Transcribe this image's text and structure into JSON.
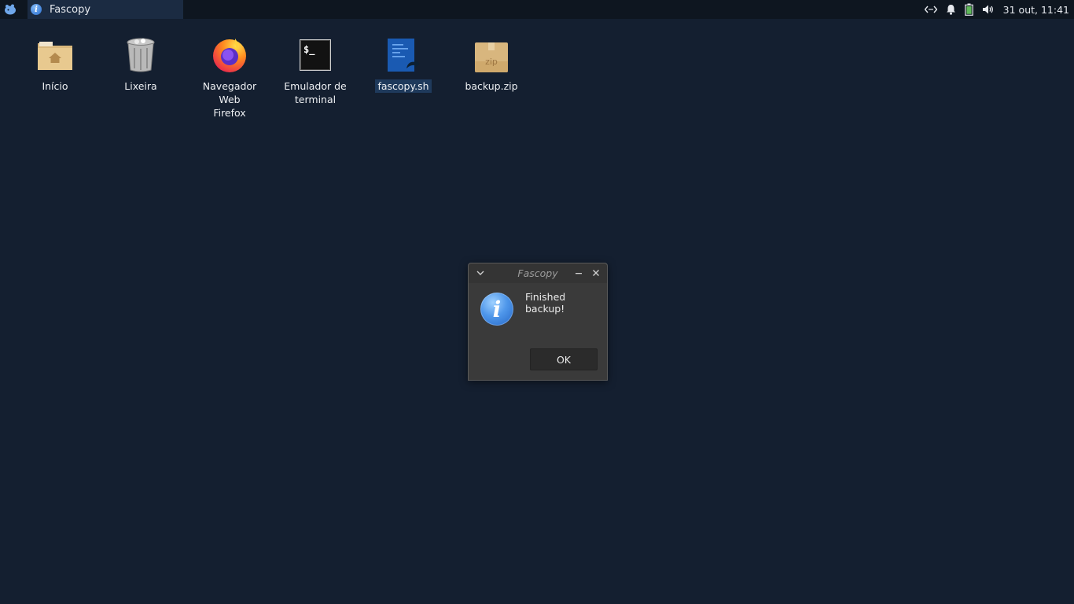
{
  "panel": {
    "task_title": "Fascopy",
    "clock": "31 out, 11:41",
    "tray_icons": [
      "network-icon",
      "notification-bell-icon",
      "battery-icon",
      "volume-icon"
    ]
  },
  "desktop": {
    "icons": [
      {
        "label": "Início",
        "icon": "home-folder-icon"
      },
      {
        "label": "Lixeira",
        "icon": "trash-icon"
      },
      {
        "label": "Navegador Web Firefox",
        "icon": "firefox-icon"
      },
      {
        "label": "Emulador de terminal",
        "icon": "terminal-icon"
      },
      {
        "label": "fascopy.sh",
        "icon": "script-file-icon"
      },
      {
        "label": "backup.zip",
        "icon": "zip-archive-icon"
      }
    ],
    "terminal_glyph": "$_",
    "zip_glyph": "zip"
  },
  "dialog": {
    "title": "Fascopy",
    "message": "Finished backup!",
    "ok_label": "OK"
  },
  "colors": {
    "desktop_bg": "#141f30",
    "panel_bg": "#0e1620",
    "task_active_bg": "#1b2b42",
    "dialog_bg": "#3a3a3a",
    "info_blue": "#4f97ea"
  }
}
